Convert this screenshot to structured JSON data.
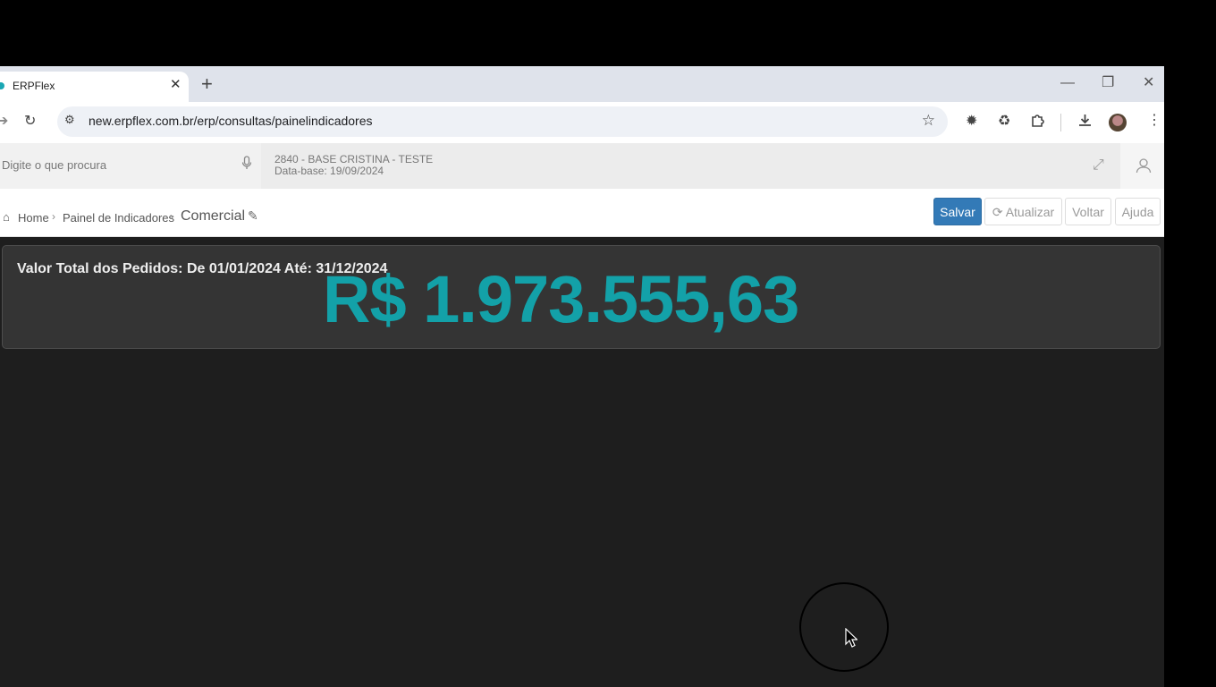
{
  "browser": {
    "tab_title": "ERPFlex",
    "tab_close": "✕",
    "new_tab": "+",
    "url": "new.erpflex.com.br/erp/consultas/painelindicadores",
    "window_controls": {
      "minimize": "—",
      "restore": "❐",
      "close": "✕"
    }
  },
  "erp_header": {
    "search_placeholder": "Digite o que procura",
    "company_line1": "2840 - BASE CRISTINA - TESTE",
    "company_line2": "Data-base: 19/09/2024"
  },
  "breadcrumb": {
    "home": "Home",
    "sep": "›",
    "panel": "Painel de Indicadores",
    "current": "Comercial"
  },
  "actions": {
    "save": "Salvar",
    "refresh": "Atualizar",
    "back": "Voltar",
    "help": "Ajuda"
  },
  "indicator": {
    "label": "Valor Total dos Pedidos: De 01/01/2024 Até: 31/12/2024",
    "value": "R$ 1.973.555,63",
    "value_color": "#13a1a8"
  },
  "colors": {
    "accent": "#337ab7",
    "content_bg": "#1e1e1e",
    "card_bg": "#343434"
  }
}
